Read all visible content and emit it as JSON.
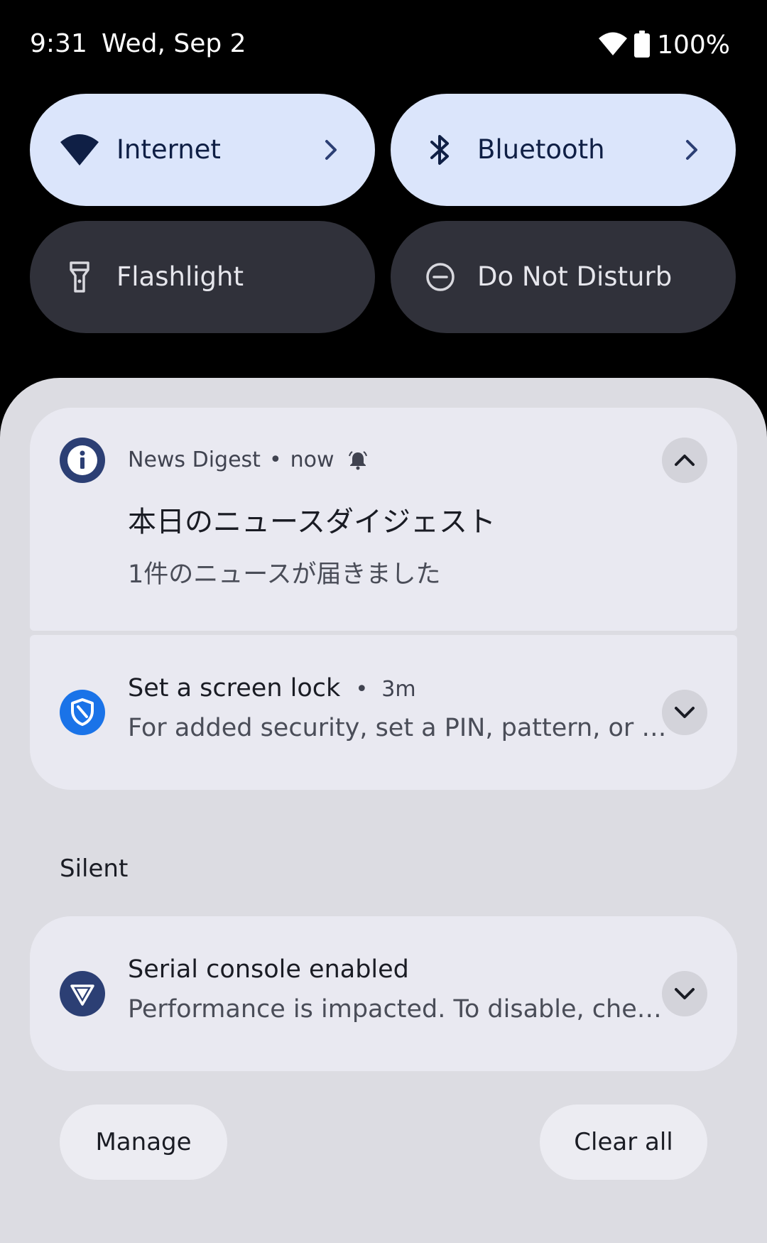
{
  "status_bar": {
    "time": "9:31",
    "date": "Wed, Sep 2",
    "battery": "100%",
    "icons": [
      "wifi-icon",
      "battery-icon"
    ]
  },
  "quick_settings": {
    "tiles": [
      {
        "label": "Internet",
        "state": "on",
        "icon": "wifi-icon",
        "has_chevron": true
      },
      {
        "label": "Bluetooth",
        "state": "on",
        "icon": "bluetooth-icon",
        "has_chevron": true
      },
      {
        "label": "Flashlight",
        "state": "off",
        "icon": "flashlight-icon",
        "has_chevron": false
      },
      {
        "label": "Do Not Disturb",
        "state": "off",
        "icon": "do-not-disturb-icon",
        "has_chevron": false
      }
    ]
  },
  "notifications": {
    "news": {
      "app_name": "News Digest",
      "separator": "•",
      "time": "now",
      "title": "本日のニュースダイジェスト",
      "text": "1件のニュースが届きました",
      "icon": "info-icon",
      "expand_icon": "chevron-up-icon"
    },
    "lock": {
      "title": "Set a screen lock",
      "separator": "•",
      "time": "3m",
      "text": "For added security, set a PIN, pattern, or p…",
      "icon": "shield-icon",
      "expand_icon": "chevron-down-icon"
    },
    "silent_label": "Silent",
    "serial": {
      "title": "Serial console enabled",
      "text": "Performance is impacted. To disable, che…",
      "icon": "bug-shield-icon",
      "expand_icon": "chevron-down-icon"
    }
  },
  "footer": {
    "manage_label": "Manage",
    "clear_all_label": "Clear all"
  },
  "colors": {
    "background": "#000000",
    "tile_active": "#dbe5fb",
    "tile_inactive": "#30313a",
    "shade": "#dcdce2",
    "card": "#e9e9f1",
    "accent_dark": "#2c3f74",
    "accent_blue": "#1a73e8"
  }
}
